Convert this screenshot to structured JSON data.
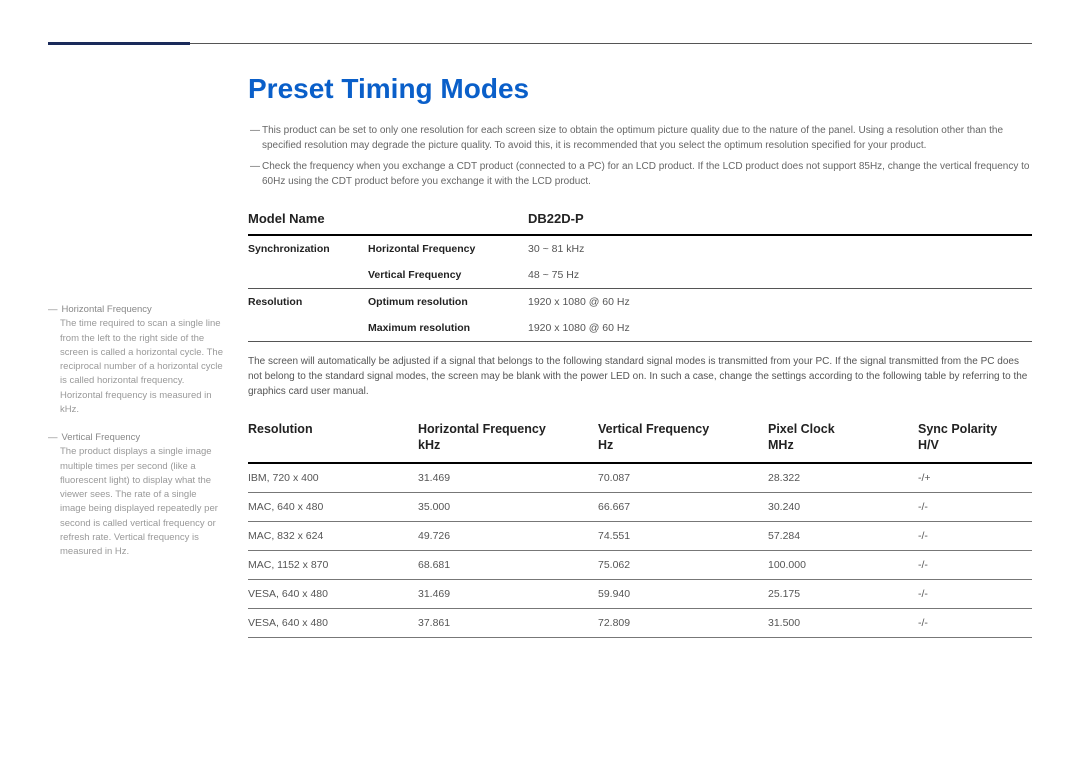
{
  "title": "Preset Timing Modes",
  "notes": [
    "This product can be set to only one resolution for each screen size to obtain the optimum picture quality due to the nature of the panel. Using a resolution other than the specified resolution may degrade the picture quality. To avoid this, it is recommended that you select the optimum resolution specified for your product.",
    "Check the frequency when you exchange a CDT product (connected to a PC) for an LCD product. If the LCD product does not support 85Hz, change the vertical frequency to 60Hz using the CDT product before you exchange it with the LCD product."
  ],
  "spec": {
    "model_label": "Model Name",
    "model_value": "DB22D-P",
    "rows": [
      {
        "cat": "Synchronization",
        "sub": "Horizontal Frequency",
        "val": "30 ~ 81 kHz"
      },
      {
        "cat": "",
        "sub": "Vertical Frequency",
        "val": "48 ~ 75 Hz"
      },
      {
        "cat": "Resolution",
        "sub": "Optimum resolution",
        "val": "1920 x 1080 @ 60 Hz"
      },
      {
        "cat": "",
        "sub": "Maximum resolution",
        "val": "1920 x 1080 @ 60 Hz"
      }
    ]
  },
  "desc": "The screen will automatically be adjusted if a signal that belongs to the following standard signal modes is transmitted from your PC. If the signal transmitted from the PC does not belong to the standard signal modes, the screen may be blank with the power LED on. In such a case, change the settings according to the following table by referring to the graphics card user manual.",
  "timing_headers": {
    "c1a": "Resolution",
    "c1b": "",
    "c2a": "Horizontal Frequency",
    "c2b": "kHz",
    "c3a": "Vertical Frequency",
    "c3b": "Hz",
    "c4a": "Pixel Clock",
    "c4b": "MHz",
    "c5a": "Sync Polarity",
    "c5b": "H/V"
  },
  "timing_rows": [
    {
      "r": "IBM, 720 x 400",
      "h": "31.469",
      "v": "70.087",
      "p": "28.322",
      "s": "-/+"
    },
    {
      "r": "MAC, 640 x 480",
      "h": "35.000",
      "v": "66.667",
      "p": "30.240",
      "s": "-/-"
    },
    {
      "r": "MAC, 832 x 624",
      "h": "49.726",
      "v": "74.551",
      "p": "57.284",
      "s": "-/-"
    },
    {
      "r": "MAC, 1152 x 870",
      "h": "68.681",
      "v": "75.062",
      "p": "100.000",
      "s": "-/-"
    },
    {
      "r": "VESA, 640 x 480",
      "h": "31.469",
      "v": "59.940",
      "p": "25.175",
      "s": "-/-"
    },
    {
      "r": "VESA, 640 x 480",
      "h": "37.861",
      "v": "72.809",
      "p": "31.500",
      "s": "-/-"
    }
  ],
  "sidebar": [
    {
      "title": "Horizontal Frequency",
      "body": "The time required to scan a single line from the left to the right side of the screen is called a horizontal cycle. The reciprocal number of a horizontal cycle is called horizontal frequency. Horizontal frequency is measured in kHz."
    },
    {
      "title": "Vertical Frequency",
      "body": "The product displays a single image multiple times per second (like a fluorescent light) to display what the viewer sees. The rate of a single image being displayed repeatedly per second is called vertical frequency or refresh rate. Vertical frequency is measured in Hz."
    }
  ]
}
